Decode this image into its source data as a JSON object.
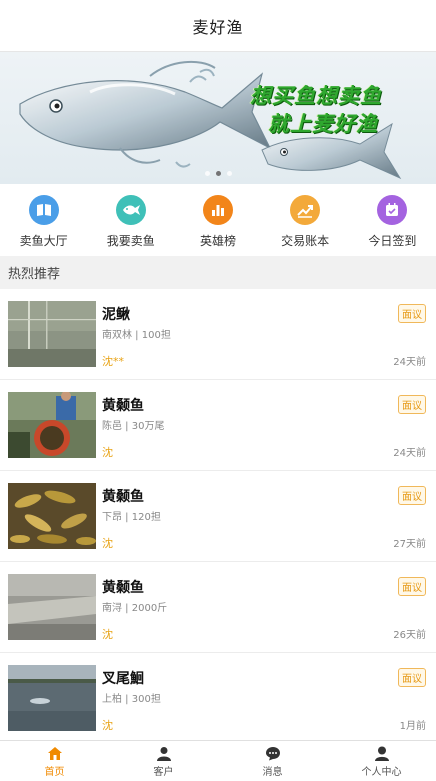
{
  "header": {
    "title": "麦好渔"
  },
  "banner": {
    "slogan_line1": "想买鱼想卖鱼",
    "slogan_line2": "就上麦好渔",
    "slide_count": 3,
    "active_slide": 2
  },
  "quicknav": [
    {
      "label": "卖鱼大厅",
      "icon": "book-icon",
      "color": "#4a9ee8"
    },
    {
      "label": "我要卖鱼",
      "icon": "fish-icon",
      "color": "#3fc0b8"
    },
    {
      "label": "英雄榜",
      "icon": "bar-chart-icon",
      "color": "#f2851a"
    },
    {
      "label": "交易账本",
      "icon": "trend-icon",
      "color": "#f3a93a"
    },
    {
      "label": "今日签到",
      "icon": "calendar-check-icon",
      "color": "#a463e0"
    }
  ],
  "section": {
    "title": "热烈推荐"
  },
  "listings": [
    {
      "name": "泥鳅",
      "meta": "南双林 | 100担",
      "seller": "沈**",
      "time": "24天前",
      "price_tag": "面议"
    },
    {
      "name": "黄颡鱼",
      "meta": "陈邑 | 30万尾",
      "seller": "沈",
      "time": "24天前",
      "price_tag": "面议"
    },
    {
      "name": "黄颡鱼",
      "meta": "下昂 | 120担",
      "seller": "沈",
      "time": "27天前",
      "price_tag": "面议"
    },
    {
      "name": "黄颡鱼",
      "meta": "南浔 | 2000斤",
      "seller": "沈",
      "time": "26天前",
      "price_tag": "面议"
    },
    {
      "name": "叉尾鮰",
      "meta": "上柏 | 300担",
      "seller": "沈",
      "time": "1月前",
      "price_tag": "面议"
    }
  ],
  "tabbar": {
    "active": 0,
    "items": [
      {
        "label": "首页",
        "icon": "home-icon"
      },
      {
        "label": "客户",
        "icon": "customer-icon"
      },
      {
        "label": "消息",
        "icon": "message-icon"
      },
      {
        "label": "个人中心",
        "icon": "user-icon"
      }
    ]
  },
  "colors": {
    "accent": "#f08a00",
    "price_tag": "#e79a16"
  }
}
